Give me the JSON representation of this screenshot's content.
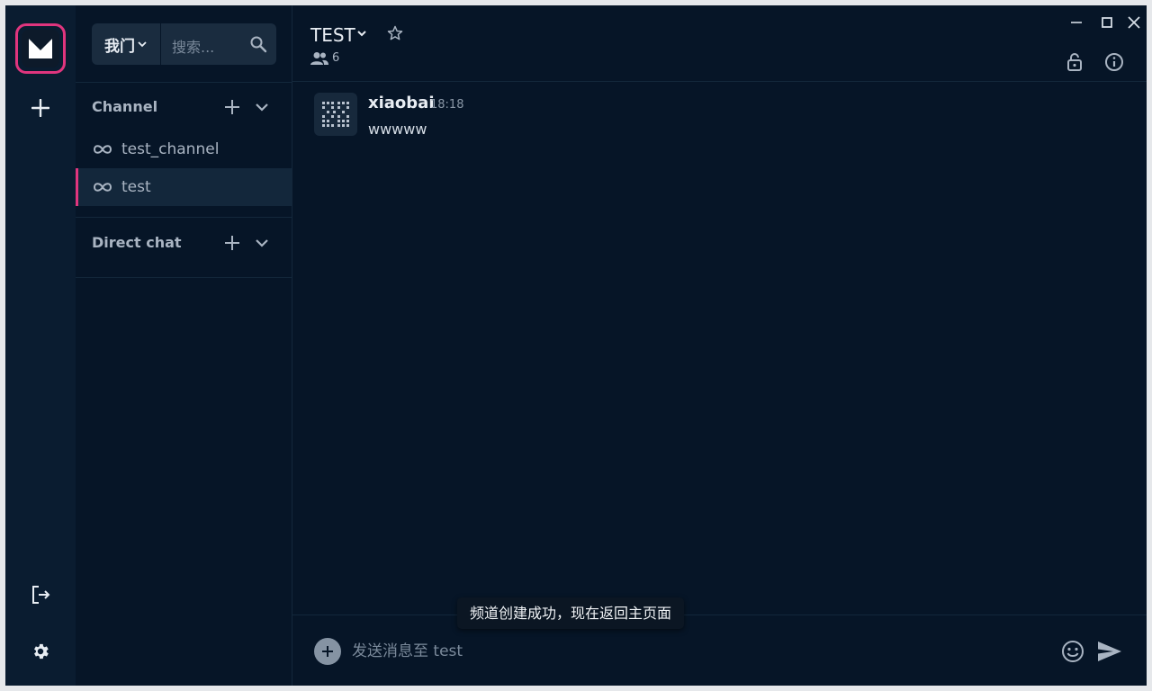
{
  "workspace": {
    "label": "我门"
  },
  "search": {
    "placeholder": "搜索..."
  },
  "sections": {
    "channel": {
      "title": "Channel"
    },
    "direct": {
      "title": "Direct chat"
    }
  },
  "channels": [
    {
      "label": "test_channel",
      "active": false
    },
    {
      "label": "test",
      "active": true
    }
  ],
  "room": {
    "title": "TEST",
    "member_count": "6"
  },
  "messages": [
    {
      "user": "xiaobai",
      "time": "18:18",
      "text": "wwwww"
    }
  ],
  "composer": {
    "placeholder": "发送消息至 test"
  },
  "toast": {
    "text": "频道创建成功，现在返回主页面"
  },
  "colors": {
    "accent": "#e0357e",
    "background": "#061527",
    "rail": "#0a1c30",
    "surface": "#1a2c3f",
    "text": "#e8edf3",
    "muted": "#a9b4c2"
  },
  "icons": [
    "app-logo",
    "plus-icon",
    "logout-icon",
    "settings-icon",
    "search-icon",
    "infinity-icon",
    "chevron-down-icon",
    "star-icon",
    "members-icon",
    "minimize-icon",
    "maximize-icon",
    "close-icon",
    "lock-icon",
    "info-icon",
    "emoji-icon",
    "send-icon"
  ]
}
